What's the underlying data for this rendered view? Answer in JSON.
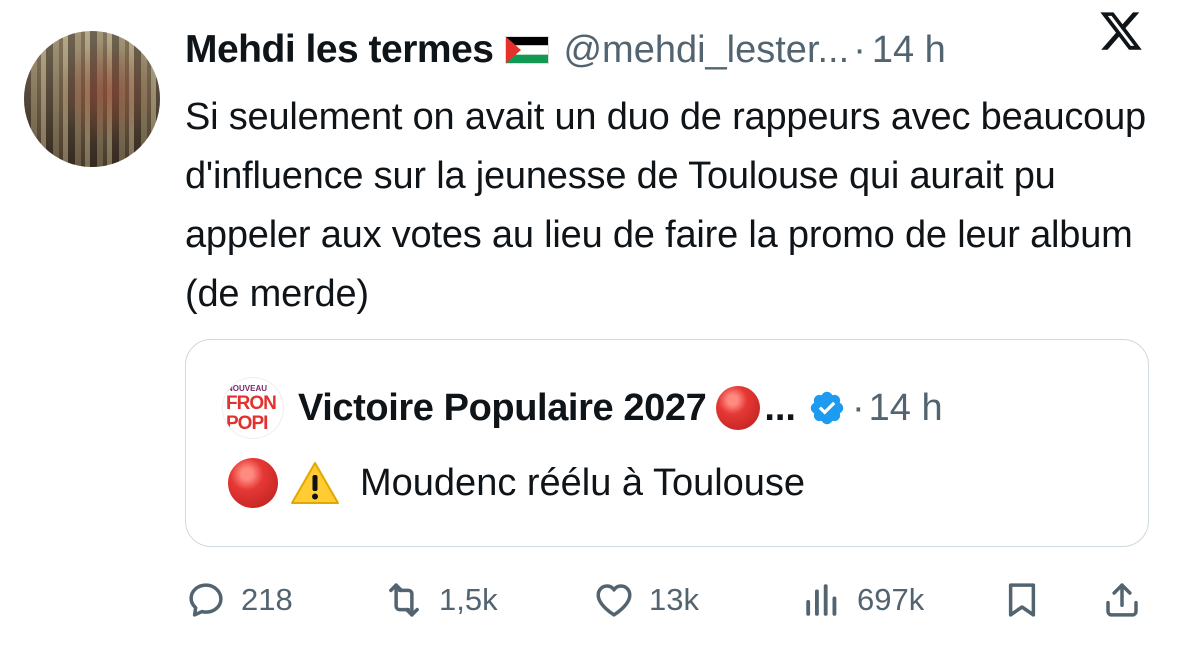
{
  "tweet": {
    "author_name": "Mehdi les termes",
    "handle": "@mehdi_lester...",
    "separator": "·",
    "time": "14 h",
    "text": "Si seulement on avait un duo de rappeurs avec beaucoup d'influence sur la jeunesse de Toulouse qui aurait pu appeler aux votes au lieu de faire la promo de leur album (de merde)"
  },
  "quoted": {
    "logo_lines": [
      "NOUVEAU",
      "FRON",
      "POPI"
    ],
    "author_name": "Victoire Populaire 2027",
    "ellipsis": "...",
    "separator": "·",
    "time": "14 h",
    "text": "Moudenc réélu à Toulouse"
  },
  "actions": {
    "replies": "218",
    "reposts": "1,5k",
    "likes": "13k",
    "views": "697k"
  },
  "icons": [
    "avatar",
    "palestine-flag-icon",
    "x-logo-icon",
    "red-circle-icon",
    "verified-badge-icon",
    "warning-icon",
    "reply-icon",
    "repost-icon",
    "like-icon",
    "views-icon",
    "bookmark-icon",
    "share-icon"
  ],
  "colors": {
    "text": "#0f1419",
    "secondary": "#536471",
    "border": "#cfd9de",
    "verified": "#1d9bf0"
  }
}
